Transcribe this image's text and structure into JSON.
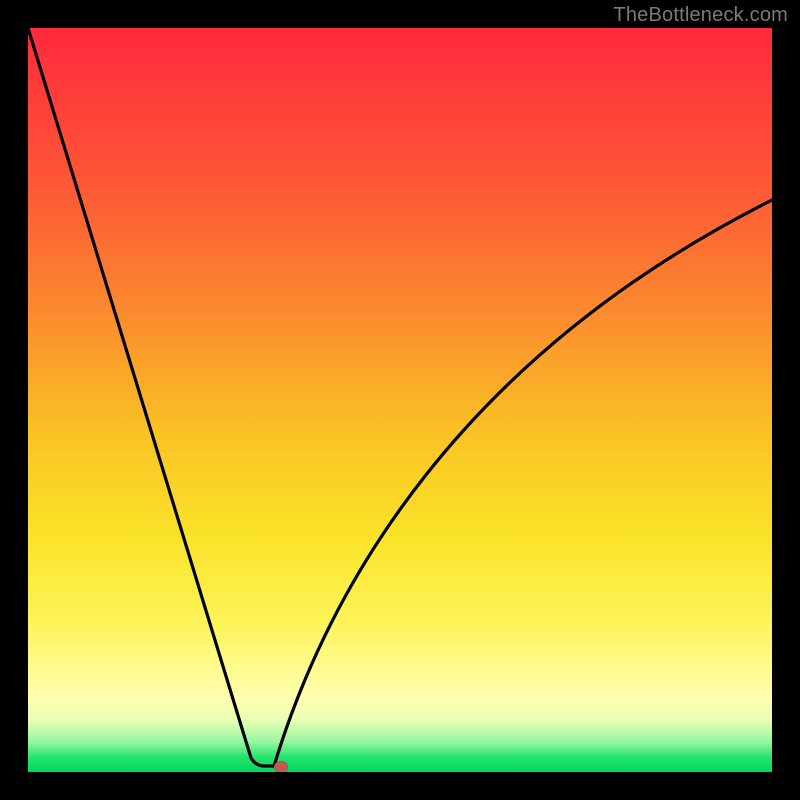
{
  "watermark": "TheBottleneck.com",
  "chart_data": {
    "type": "line",
    "title": "",
    "xlabel": "",
    "ylabel": "",
    "x": [
      0.0,
      0.05,
      0.1,
      0.15,
      0.2,
      0.25,
      0.3,
      0.33,
      0.35,
      0.4,
      0.45,
      0.5,
      0.55,
      0.6,
      0.65,
      0.7,
      0.75,
      0.8,
      0.85,
      0.9,
      0.95,
      1.0
    ],
    "values": [
      1.0,
      0.85,
      0.7,
      0.55,
      0.4,
      0.24,
      0.08,
      0.0,
      0.06,
      0.21,
      0.33,
      0.42,
      0.49,
      0.55,
      0.6,
      0.64,
      0.67,
      0.7,
      0.72,
      0.74,
      0.76,
      0.77
    ],
    "xlim": [
      0,
      1
    ],
    "ylim": [
      0,
      1
    ],
    "minimum_x": 0.33,
    "marker": {
      "x": 0.34,
      "y": 0.005
    },
    "gradient_stops": [
      {
        "pos": 0.0,
        "color": "#fe2a3c"
      },
      {
        "pos": 0.22,
        "color": "#fd5a36"
      },
      {
        "pos": 0.55,
        "color": "#fac425"
      },
      {
        "pos": 0.8,
        "color": "#fdf45a"
      },
      {
        "pos": 0.96,
        "color": "#94f7a0"
      },
      {
        "pos": 1.0,
        "color": "#00d860"
      }
    ]
  }
}
